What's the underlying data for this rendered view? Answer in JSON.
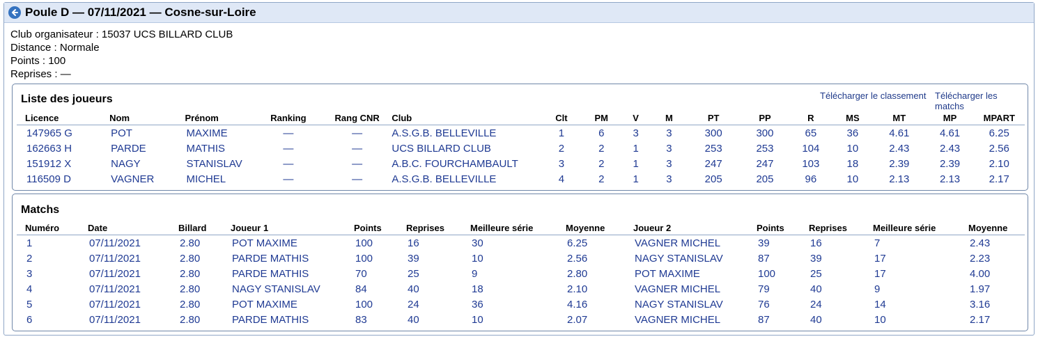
{
  "header": {
    "title": "Poule D — 07/11/2021 — Cosne-sur-Loire"
  },
  "info": {
    "club": "Club organisateur : 15037 UCS BILLARD CLUB",
    "distance": "Distance : Normale",
    "points": "Points : 100",
    "reprises": "Reprises : —"
  },
  "players": {
    "title": "Liste des joueurs",
    "download_ranking": "Télécharger le classement",
    "download_matches": "Télécharger les matchs",
    "columns": [
      "Licence",
      "Nom",
      "Prénom",
      "Ranking",
      "Rang CNR",
      "Club",
      "Clt",
      "PM",
      "V",
      "M",
      "PT",
      "PP",
      "R",
      "MS",
      "MT",
      "MP",
      "MPART"
    ],
    "rows": [
      [
        "147965 G",
        "POT",
        "MAXIME",
        "—",
        "—",
        "A.S.G.B. BELLEVILLE",
        "1",
        "6",
        "3",
        "3",
        "300",
        "300",
        "65",
        "36",
        "4.61",
        "4.61",
        "6.25"
      ],
      [
        "162663 H",
        "PARDE",
        "MATHIS",
        "—",
        "—",
        "UCS BILLARD CLUB",
        "2",
        "2",
        "1",
        "3",
        "253",
        "253",
        "104",
        "10",
        "2.43",
        "2.43",
        "2.56"
      ],
      [
        "151912 X",
        "NAGY",
        "STANISLAV",
        "—",
        "—",
        "A.B.C. FOURCHAMBAULT",
        "3",
        "2",
        "1",
        "3",
        "247",
        "247",
        "103",
        "18",
        "2.39",
        "2.39",
        "2.10"
      ],
      [
        "116509 D",
        "VAGNER",
        "MICHEL",
        "—",
        "—",
        "A.S.G.B. BELLEVILLE",
        "4",
        "2",
        "1",
        "3",
        "205",
        "205",
        "96",
        "10",
        "2.13",
        "2.13",
        "2.17"
      ]
    ]
  },
  "matches": {
    "title": "Matchs",
    "columns": [
      "Numéro",
      "Date",
      "Billard",
      "Joueur 1",
      "Points",
      "Reprises",
      "Meilleure série",
      "Moyenne",
      "Joueur 2",
      "Points",
      "Reprises",
      "Meilleure série",
      "Moyenne"
    ],
    "rows": [
      [
        "1",
        "07/11/2021",
        "2.80",
        "POT MAXIME",
        "100",
        "16",
        "30",
        "6.25",
        "VAGNER MICHEL",
        "39",
        "16",
        "7",
        "2.43"
      ],
      [
        "2",
        "07/11/2021",
        "2.80",
        "PARDE MATHIS",
        "100",
        "39",
        "10",
        "2.56",
        "NAGY STANISLAV",
        "87",
        "39",
        "17",
        "2.23"
      ],
      [
        "3",
        "07/11/2021",
        "2.80",
        "PARDE MATHIS",
        "70",
        "25",
        "9",
        "2.80",
        "POT MAXIME",
        "100",
        "25",
        "17",
        "4.00"
      ],
      [
        "4",
        "07/11/2021",
        "2.80",
        "NAGY STANISLAV",
        "84",
        "40",
        "18",
        "2.10",
        "VAGNER MICHEL",
        "79",
        "40",
        "9",
        "1.97"
      ],
      [
        "5",
        "07/11/2021",
        "2.80",
        "POT MAXIME",
        "100",
        "24",
        "36",
        "4.16",
        "NAGY STANISLAV",
        "76",
        "24",
        "14",
        "3.16"
      ],
      [
        "6",
        "07/11/2021",
        "2.80",
        "PARDE MATHIS",
        "83",
        "40",
        "10",
        "2.07",
        "VAGNER MICHEL",
        "87",
        "40",
        "10",
        "2.17"
      ]
    ]
  }
}
